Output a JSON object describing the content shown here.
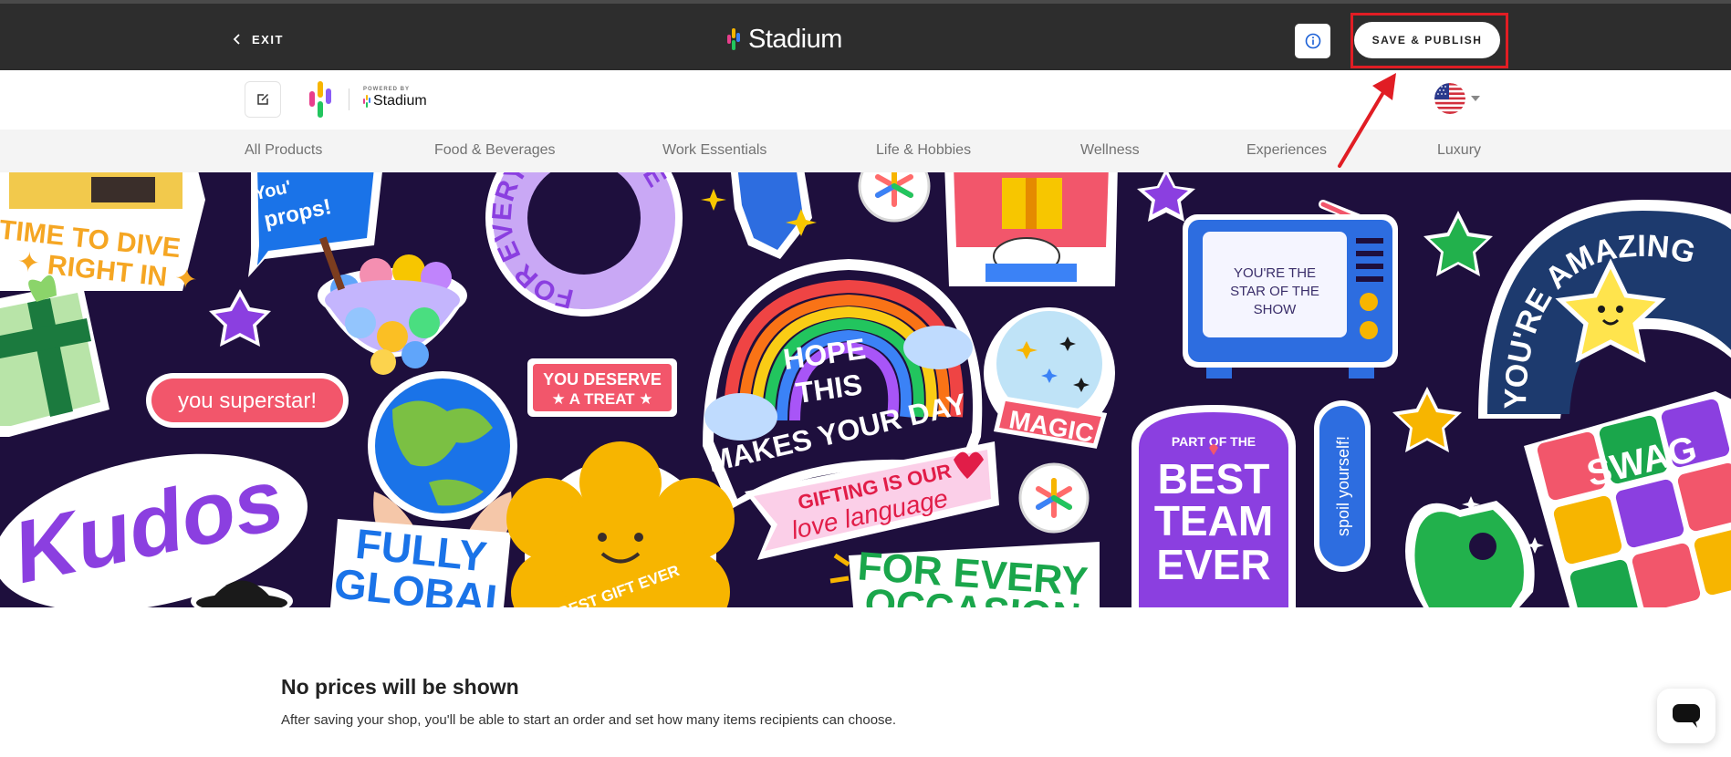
{
  "topbar": {
    "exit_label": "EXIT",
    "brand_name": "Stadium",
    "save_publish_label": "SAVE & PUBLISH"
  },
  "store_header": {
    "powered_by": "POWERED BY",
    "powered_name": "Stadium"
  },
  "categories": [
    "All Products",
    "Food & Beverages",
    "Work Essentials",
    "Life & Hobbies",
    "Wellness",
    "Experiences",
    "Luxury"
  ],
  "banner": {
    "stickers": {
      "time_to_dive_1": "TIME TO DIVE",
      "time_to_dive_2": "✦ RIGHT IN ✦",
      "props_1": "You'",
      "props_2": "props!",
      "ring_text": "FOR EVERYONE SOME",
      "you_superstar": "you superstar!",
      "you_deserve_1": "YOU DESERVE",
      "you_deserve_2": "★ A TREAT ★",
      "kudos": "Kudos",
      "fully_global_1": "FULLY",
      "fully_global_2": "GLOBAL",
      "hope_1": "HOPE",
      "hope_2": "THIS",
      "hope_3": "MAKES YOUR DAY",
      "gifting_1": "GIFTING IS OUR",
      "gifting_2": "love language",
      "best_gift_ever": "BEST GIFT EVER",
      "for_every_1": "FOR EVERY",
      "for_every_2": "OCCASION",
      "magic": "MAGIC",
      "star_show_1": "YOU'RE THE",
      "star_show_2": "STAR OF THE",
      "star_show_3": "SHOW",
      "part_of_the": "PART OF THE",
      "best": "BEST",
      "team": "TEAM",
      "ever": "EVER",
      "spoil_yourself": "spoil yourself!",
      "youre_amazing": "YOU'RE AMAZING",
      "swag": "SWAG"
    }
  },
  "notice": {
    "title": "No prices will be shown",
    "text": "After saving your shop, you'll be able to start an order and set how many items recipients can choose."
  },
  "colors": {
    "topbar_bg": "#2d2d2d",
    "banner_bg": "#1e0f3d",
    "highlight": "#e11d24",
    "info_blue": "#1a5fd6"
  }
}
